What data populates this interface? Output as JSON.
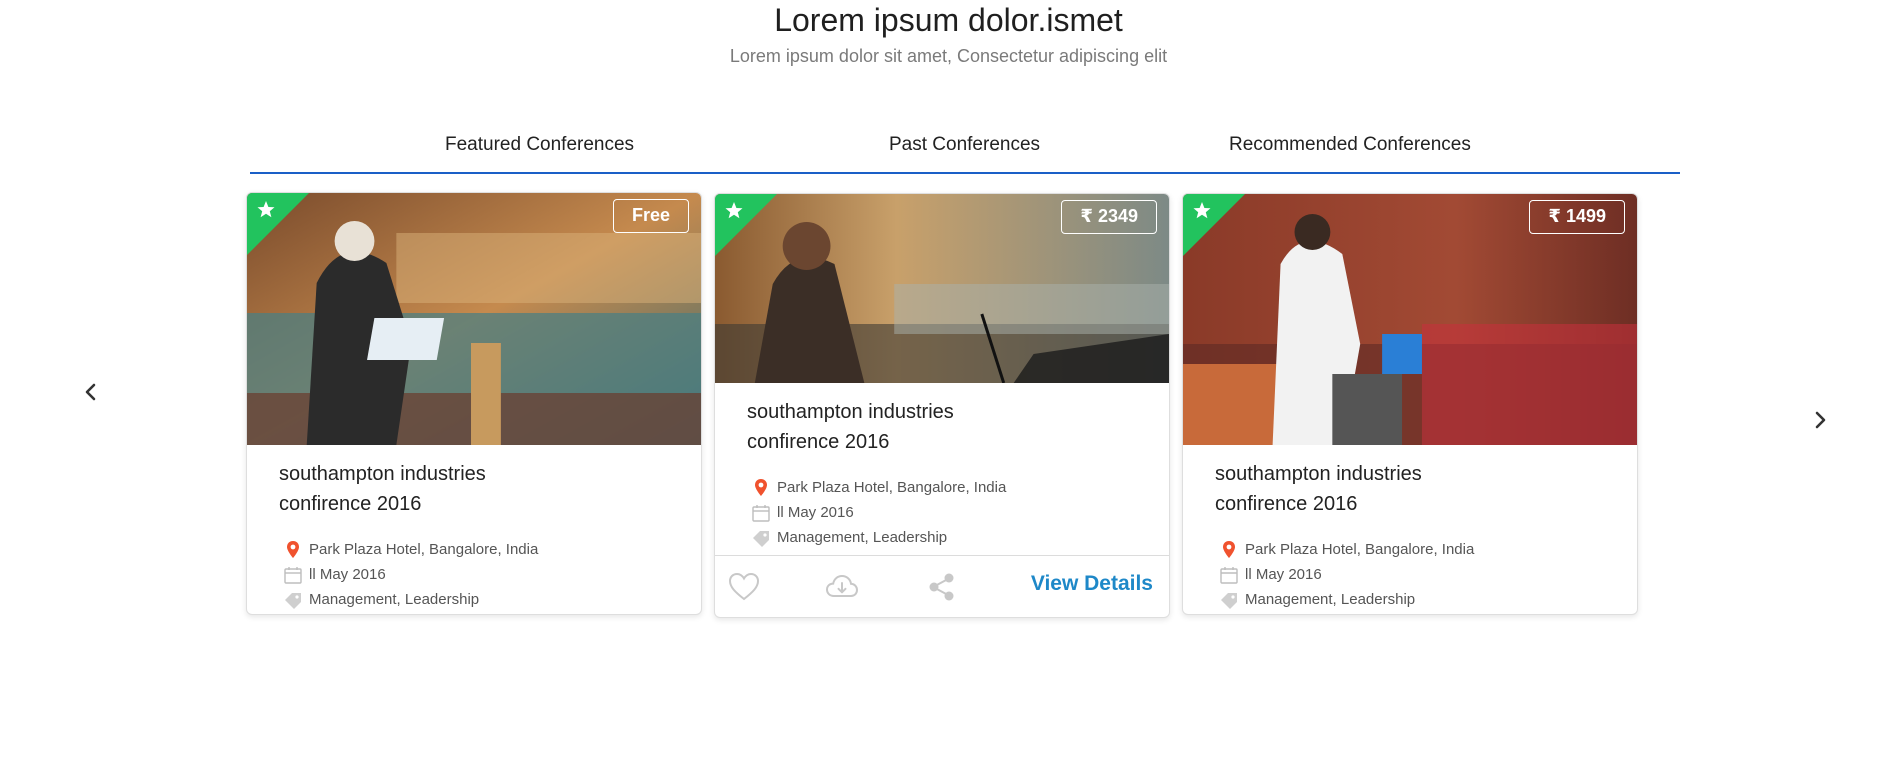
{
  "header": {
    "title": "Lorem ipsum dolor.ismet",
    "subtitle": "Lorem ipsum dolor sit amet, Consectetur adipiscing elit"
  },
  "tabs": [
    {
      "label": "Featured Conferences"
    },
    {
      "label": "Past Conferences"
    },
    {
      "label": "Recommended Conferences"
    }
  ],
  "cards": [
    {
      "price": "Free",
      "title_line1": "southampton industries",
      "title_line2": "confirence 2016",
      "location": "Park Plaza Hotel, Bangalore, India",
      "date": "ll May 2016",
      "tags": "Management, Leadership"
    },
    {
      "price": "₹ 2349",
      "title_line1": "southampton industries",
      "title_line2": "confirence 2016",
      "location": "Park Plaza Hotel, Bangalore, India",
      "date": "ll May 2016",
      "tags": "Management, Leadership",
      "view_details": "View Details"
    },
    {
      "price": "₹ 1499",
      "title_line1": "southampton industries",
      "title_line2": "confirence 2016",
      "location": "Park Plaza Hotel, Bangalore, India",
      "date": "ll May 2016",
      "tags": "Management, Leadership"
    }
  ],
  "icons": {
    "prev": "chevron-left-icon",
    "next": "chevron-right-icon",
    "ribbon": "star-icon",
    "location": "location-pin-icon",
    "date": "calendar-icon",
    "tags": "tag-icon",
    "like": "heart-icon",
    "download": "cloud-download-icon",
    "share": "share-icon"
  },
  "colors": {
    "accent_blue": "#1a5fc7",
    "link_blue": "#1e88c8",
    "ribbon_green": "#22c35e",
    "pin_red": "#f0522e"
  }
}
